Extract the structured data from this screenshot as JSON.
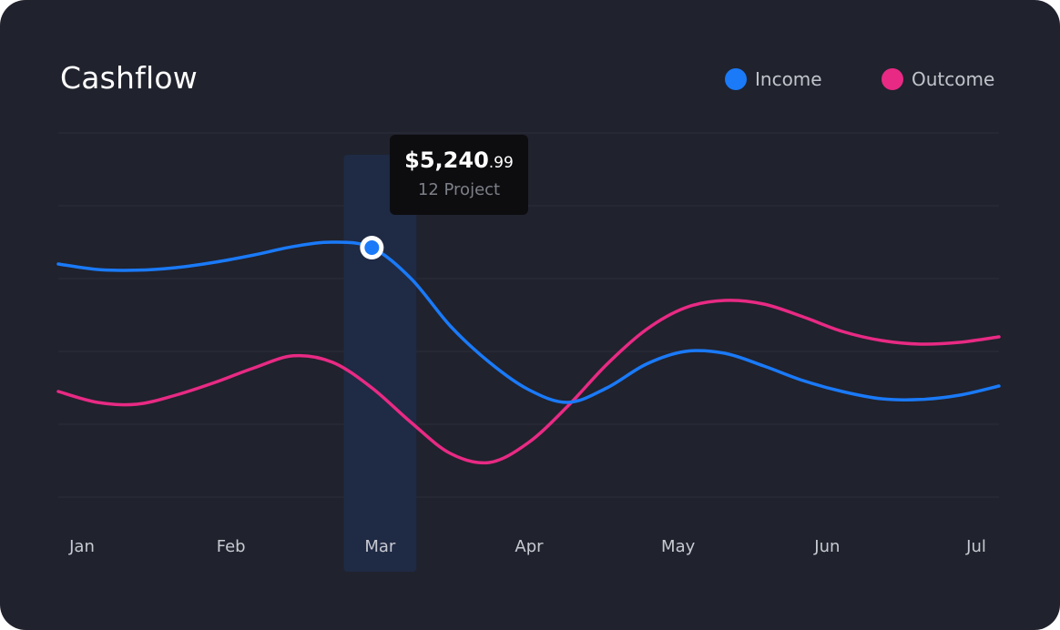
{
  "card": {
    "background": "#20222d"
  },
  "chart_data": {
    "type": "line",
    "title": "Cashflow",
    "categories": [
      "Jan",
      "Feb",
      "Mar",
      "Apr",
      "May",
      "Jun",
      "Jul"
    ],
    "x": [
      0,
      0.25,
      0.5,
      0.75,
      1,
      1.25,
      1.5,
      1.75,
      2,
      2.25,
      2.5,
      2.75,
      3,
      3.25,
      3.5,
      3.75,
      4,
      4.25,
      4.5,
      4.75,
      5,
      5.25,
      5.5,
      5.75,
      6
    ],
    "series": [
      {
        "name": "Income",
        "color": "#1a7af8",
        "values": [
          64,
          62.5,
          62.3,
          63,
          64.5,
          66.5,
          68.8,
          70,
          68.5,
          60,
          47,
          37,
          29.5,
          26,
          30,
          36.5,
          40,
          39.5,
          36,
          32,
          29,
          27,
          26.8,
          28,
          30.5
        ]
      },
      {
        "name": "Outcome",
        "color": "#e82a84",
        "values": [
          29,
          26,
          25.5,
          28,
          31.5,
          35.5,
          38.8,
          37,
          30,
          20.5,
          12,
          9.5,
          15,
          25,
          36.5,
          46,
          52,
          54,
          53,
          49.5,
          45.5,
          43,
          42,
          42.5,
          44
        ]
      }
    ],
    "gridlines": 6,
    "grid": true,
    "legend_position": "top-right",
    "highlight": {
      "category": "Mar",
      "series": "Income",
      "value_main": "$5,240",
      "value_cents": ".99",
      "subtitle": "12 Project"
    }
  }
}
